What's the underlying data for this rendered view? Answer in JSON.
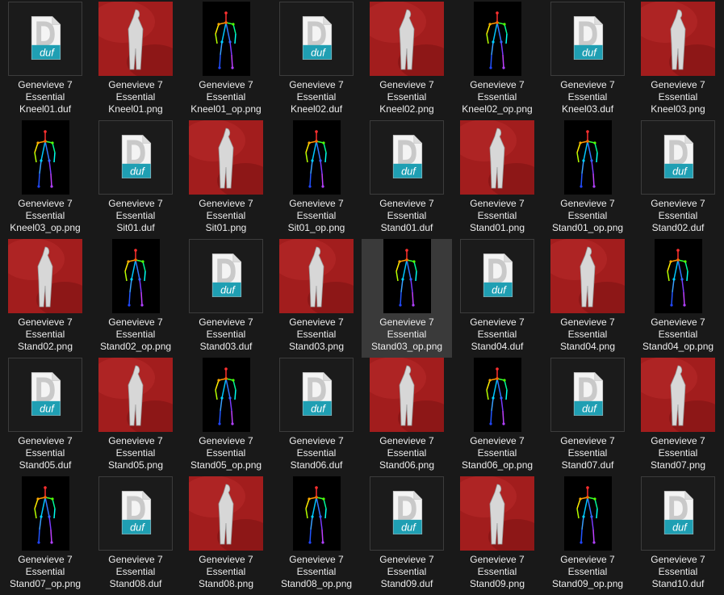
{
  "colors": {
    "background": "#191919",
    "selection": "#3a3a3a",
    "render_background": "#9b1c1c",
    "duf_badge": "#1f9fb3"
  },
  "icon_text": "duf",
  "selected_file": "Genevieve 7 Essential Stand03_op.png",
  "files": [
    {
      "line1": "Genevieve 7",
      "line2": "Essential",
      "line3": "Kneel01.duf",
      "kind": "duf-icon"
    },
    {
      "line1": "Genevieve 7",
      "line2": "Essential",
      "line3": "Kneel01.png",
      "kind": "render"
    },
    {
      "line1": "Genevieve 7",
      "line2": "Essential",
      "line3": "Kneel01_op.png",
      "kind": "pose"
    },
    {
      "line1": "Genevieve 7",
      "line2": "Essential",
      "line3": "Kneel02.duf",
      "kind": "duf-icon"
    },
    {
      "line1": "Genevieve 7",
      "line2": "Essential",
      "line3": "Kneel02.png",
      "kind": "render"
    },
    {
      "line1": "Genevieve 7",
      "line2": "Essential",
      "line3": "Kneel02_op.png",
      "kind": "pose"
    },
    {
      "line1": "Genevieve 7",
      "line2": "Essential",
      "line3": "Kneel03.duf",
      "kind": "duf-icon"
    },
    {
      "line1": "Genevieve 7",
      "line2": "Essential",
      "line3": "Kneel03.png",
      "kind": "render"
    },
    {
      "line1": "Genevieve 7",
      "line2": "Essential",
      "line3": "Kneel03_op.png",
      "kind": "pose"
    },
    {
      "line1": "Genevieve 7",
      "line2": "Essential",
      "line3": "Sit01.duf",
      "kind": "duf-icon"
    },
    {
      "line1": "Genevieve 7",
      "line2": "Essential",
      "line3": "Sit01.png",
      "kind": "render"
    },
    {
      "line1": "Genevieve 7",
      "line2": "Essential",
      "line3": "Sit01_op.png",
      "kind": "pose"
    },
    {
      "line1": "Genevieve 7",
      "line2": "Essential",
      "line3": "Stand01.duf",
      "kind": "duf-icon"
    },
    {
      "line1": "Genevieve 7",
      "line2": "Essential",
      "line3": "Stand01.png",
      "kind": "render"
    },
    {
      "line1": "Genevieve 7",
      "line2": "Essential",
      "line3": "Stand01_op.png",
      "kind": "pose"
    },
    {
      "line1": "Genevieve 7",
      "line2": "Essential",
      "line3": "Stand02.duf",
      "kind": "duf-icon"
    },
    {
      "line1": "Genevieve 7",
      "line2": "Essential",
      "line3": "Stand02.png",
      "kind": "render"
    },
    {
      "line1": "Genevieve 7",
      "line2": "Essential",
      "line3": "Stand02_op.png",
      "kind": "pose"
    },
    {
      "line1": "Genevieve 7",
      "line2": "Essential",
      "line3": "Stand03.duf",
      "kind": "duf-icon"
    },
    {
      "line1": "Genevieve 7",
      "line2": "Essential",
      "line3": "Stand03.png",
      "kind": "render"
    },
    {
      "line1": "Genevieve 7",
      "line2": "Essential",
      "line3": "Stand03_op.png",
      "kind": "pose",
      "selected": true
    },
    {
      "line1": "Genevieve 7",
      "line2": "Essential",
      "line3": "Stand04.duf",
      "kind": "duf-icon"
    },
    {
      "line1": "Genevieve 7",
      "line2": "Essential",
      "line3": "Stand04.png",
      "kind": "render"
    },
    {
      "line1": "Genevieve 7",
      "line2": "Essential",
      "line3": "Stand04_op.png",
      "kind": "pose"
    },
    {
      "line1": "Genevieve 7",
      "line2": "Essential",
      "line3": "Stand05.duf",
      "kind": "duf-icon"
    },
    {
      "line1": "Genevieve 7",
      "line2": "Essential",
      "line3": "Stand05.png",
      "kind": "render"
    },
    {
      "line1": "Genevieve 7",
      "line2": "Essential",
      "line3": "Stand05_op.png",
      "kind": "pose"
    },
    {
      "line1": "Genevieve 7",
      "line2": "Essential",
      "line3": "Stand06.duf",
      "kind": "duf-icon"
    },
    {
      "line1": "Genevieve 7",
      "line2": "Essential",
      "line3": "Stand06.png",
      "kind": "render"
    },
    {
      "line1": "Genevieve 7",
      "line2": "Essential",
      "line3": "Stand06_op.png",
      "kind": "pose"
    },
    {
      "line1": "Genevieve 7",
      "line2": "Essential",
      "line3": "Stand07.duf",
      "kind": "duf-icon"
    },
    {
      "line1": "Genevieve 7",
      "line2": "Essential",
      "line3": "Stand07.png",
      "kind": "render"
    },
    {
      "line1": "Genevieve 7",
      "line2": "Essential",
      "line3": "Stand07_op.png",
      "kind": "pose"
    },
    {
      "line1": "Genevieve 7",
      "line2": "Essential",
      "line3": "Stand08.duf",
      "kind": "duf-icon"
    },
    {
      "line1": "Genevieve 7",
      "line2": "Essential",
      "line3": "Stand08.png",
      "kind": "render"
    },
    {
      "line1": "Genevieve 7",
      "line2": "Essential",
      "line3": "Stand08_op.png",
      "kind": "pose"
    },
    {
      "line1": "Genevieve 7",
      "line2": "Essential",
      "line3": "Stand09.duf",
      "kind": "duf-icon"
    },
    {
      "line1": "Genevieve 7",
      "line2": "Essential",
      "line3": "Stand09.png",
      "kind": "render"
    },
    {
      "line1": "Genevieve 7",
      "line2": "Essential",
      "line3": "Stand09_op.png",
      "kind": "pose"
    },
    {
      "line1": "Genevieve 7",
      "line2": "Essential",
      "line3": "Stand10.duf",
      "kind": "duf-icon"
    }
  ]
}
